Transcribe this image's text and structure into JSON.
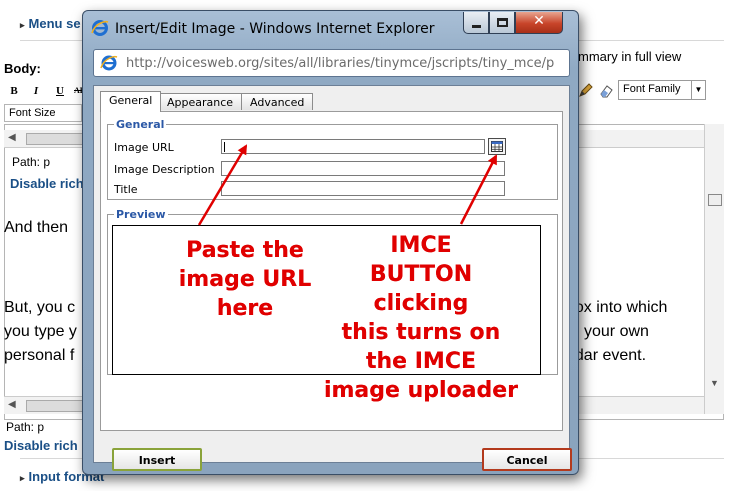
{
  "background_page": {
    "menu_settings": "Menu se",
    "body_label": "Body:",
    "summary_text": "mmary in full view",
    "toolbar": {
      "bold": "B",
      "italic": "I",
      "underline": "U",
      "strike": "ABC"
    },
    "font_family_select": "Font Family",
    "font_size_select": "Font Size",
    "path_top": "Path: p",
    "disable_rich_top": "Disable rich",
    "editor_lines": {
      "line1": "And then",
      "line2": "But, you c",
      "line3": "you type y",
      "line4": "personal f",
      "line5": "box into which",
      "line6": "your own",
      "line7": "ndar event."
    },
    "path_bottom": "Path: p",
    "disable_rich_bottom": "Disable rich",
    "input_format": "Input format"
  },
  "window": {
    "title": "Insert/Edit Image - Windows Internet Explorer",
    "address": "http://voicesweb.org/sites/all/libraries/tinymce/jscripts/tiny_mce/p",
    "close_glyph": "✕"
  },
  "dialog": {
    "tabs": [
      {
        "label": "General",
        "active": true
      },
      {
        "label": "Appearance",
        "active": false
      },
      {
        "label": "Advanced",
        "active": false
      }
    ],
    "general_legend": "General",
    "fields": {
      "image_url": {
        "label": "Image URL",
        "value": ""
      },
      "image_description": {
        "label": "Image Description",
        "value": ""
      },
      "title": {
        "label": "Title",
        "value": ""
      }
    },
    "preview_legend": "Preview",
    "insert_label": "Insert",
    "cancel_label": "Cancel"
  },
  "annotations": {
    "paste_note": [
      "Paste the",
      "image URL",
      "here"
    ],
    "imce_note": [
      "IMCE",
      "BUTTON",
      "clicking",
      "this turns on",
      "the IMCE",
      "image uploader"
    ],
    "color": "#e00000"
  }
}
